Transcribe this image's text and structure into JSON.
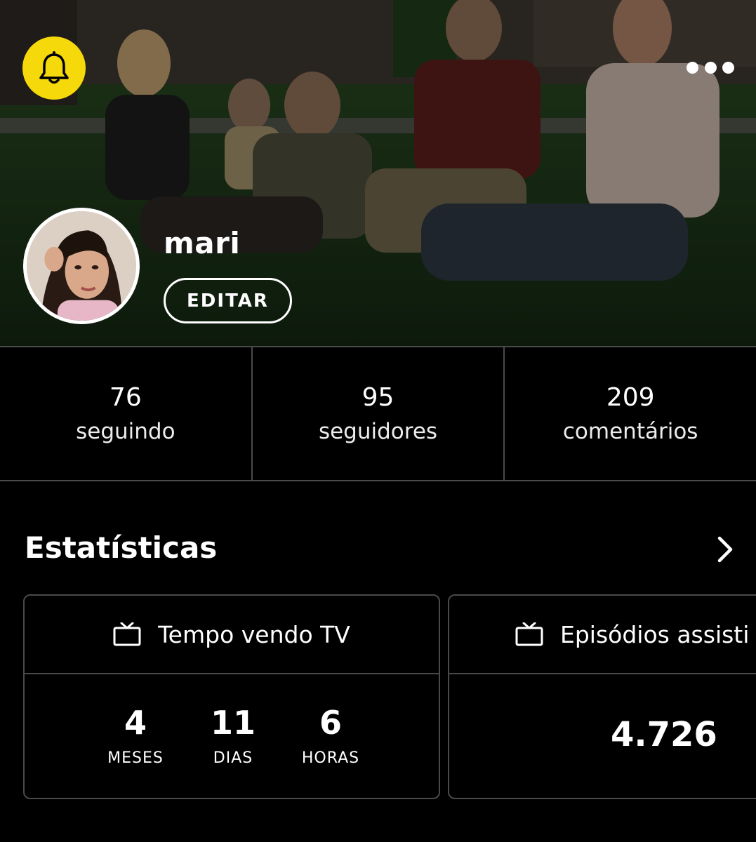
{
  "profile": {
    "username": "mari",
    "edit_label": "EDITAR"
  },
  "header": {
    "notification_icon": "bell-icon",
    "more_icon": "more-dots-icon",
    "accent_color": "#f5d90a"
  },
  "counters": [
    {
      "value": "76",
      "label": "seguindo"
    },
    {
      "value": "95",
      "label": "seguidores"
    },
    {
      "value": "209",
      "label": "comentários"
    }
  ],
  "stats": {
    "title": "Estatísticas",
    "cards": [
      {
        "icon": "tv-icon",
        "title": "Tempo vendo TV",
        "units": [
          {
            "value": "4",
            "label": "MESES"
          },
          {
            "value": "11",
            "label": "DIAS"
          },
          {
            "value": "6",
            "label": "HORAS"
          }
        ]
      },
      {
        "icon": "tv-icon",
        "title": "Episódios assisti",
        "value": "4.726"
      }
    ]
  }
}
